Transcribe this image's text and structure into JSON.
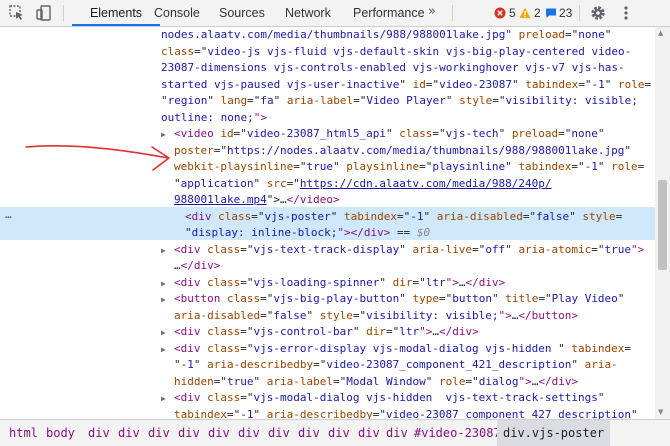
{
  "toolbar": {
    "tabs": [
      "Elements",
      "Console",
      "Sources",
      "Network",
      "Performance"
    ],
    "more": "»",
    "errors": "5",
    "warnings": "2",
    "messages": "23"
  },
  "dom": {
    "l0": [
      "nodes.alaatv.com/media/thumbnails/988/988001lake.jpg\"",
      " preload",
      "=\"",
      "none",
      "\""
    ],
    "l1": [
      "class",
      "=\"",
      "video-js vjs-fluid vjs-default-skin vjs-big-play-centered video-"
    ],
    "l2": [
      "23087-dimensions vjs-controls-enabled vjs-workinghover vjs-v7 vjs-has-"
    ],
    "l3": [
      "started vjs-paused vjs-user-inactive",
      "\" ",
      "id",
      "=\"",
      "video-23087",
      "\" ",
      "tabindex",
      "=\"",
      "-1",
      "\" ",
      "role",
      "="
    ],
    "l4": [
      "\"",
      "region",
      "\" ",
      "lang",
      "=\"",
      "fa",
      "\" ",
      "aria-label",
      "=\"",
      "Video Player",
      "\" ",
      "style",
      "=\"",
      "visibility: visible;"
    ],
    "l5": [
      "outline: none;",
      "\">"
    ],
    "l6": [
      "<video",
      " id",
      "=\"",
      "video-23087_html5_api",
      "\" ",
      "class",
      "=\"",
      "vjs-tech",
      "\" ",
      "preload",
      "=\"",
      "none",
      "\""
    ],
    "l7": [
      "poster",
      "=\"",
      "https://nodes.alaatv.com/media/thumbnails/988/988001lake.jpg",
      "\""
    ],
    "l8": [
      "webkit-playsinline",
      "=\"",
      "true",
      "\" ",
      "playsinline",
      "=\"",
      "playsinline",
      "\" ",
      "tabindex",
      "=\"",
      "-1",
      "\" ",
      "role",
      "="
    ],
    "l9": [
      "\"",
      "application",
      "\" ",
      "src",
      "=\"",
      "https://cdn.alaatv.com/media/988/240p/"
    ],
    "l10": [
      "988001lake.mp4",
      "\">",
      "…",
      "</video>"
    ],
    "l11": [
      "<div",
      " class",
      "=\"",
      "vjs-poster",
      "\" ",
      "tabindex",
      "=\"",
      "-1",
      "\" ",
      "aria-disabled",
      "=\"",
      "false",
      "\" ",
      "style",
      "="
    ],
    "l12": [
      "\"",
      "display: inline-block;",
      "\">",
      "</div>",
      " == ",
      "$0"
    ],
    "l13": [
      "<div",
      " class",
      "=\"",
      "vjs-text-track-display",
      "\" ",
      "aria-live",
      "=\"",
      "off",
      "\" ",
      "aria-atomic",
      "=\"",
      "true",
      "\">"
    ],
    "l14": [
      "…",
      "</div>"
    ],
    "l15": [
      "<div",
      " class",
      "=\"",
      "vjs-loading-spinner",
      "\" ",
      "dir",
      "=\"",
      "ltr",
      "\">",
      "…",
      "</div>"
    ],
    "l16": [
      "<button",
      " class",
      "=\"",
      "vjs-big-play-button",
      "\" ",
      "type",
      "=\"",
      "button",
      "\" ",
      "title",
      "=\"",
      "Play Video",
      "\""
    ],
    "l17": [
      "aria-disabled",
      "=\"",
      "false",
      "\" ",
      "style",
      "=\"",
      "visibility: visible;",
      "\">",
      "…",
      "</button>"
    ],
    "l18": [
      "<div",
      " class",
      "=\"",
      "vjs-control-bar",
      "\" ",
      "dir",
      "=\"",
      "ltr",
      "\">",
      "…",
      "</div>"
    ],
    "l19": [
      "<div",
      " class",
      "=\"",
      "vjs-error-display vjs-modal-dialog vjs-hidden ",
      "\" ",
      "tabindex",
      "="
    ],
    "l20": [
      "\"",
      "-1",
      "\" ",
      "aria-describedby",
      "=\"",
      "video-23087_component_421_description",
      "\" ",
      "aria-"
    ],
    "l21": [
      "hidden",
      "=\"",
      "true",
      "\" ",
      "aria-label",
      "=\"",
      "Modal Window",
      "\" ",
      "role",
      "=\"",
      "dialog",
      "\">",
      "…",
      "</div>"
    ],
    "l22": [
      "<div",
      " class",
      "=\"",
      "vjs-modal-dialog vjs-hidden  vjs-text-track-settings",
      "\""
    ],
    "l23": [
      "tabindex",
      "=\"",
      "-1",
      "\" ",
      "aria-describedby",
      "=\"",
      "video-23087_component_427_description",
      "\""
    ],
    "dots": "…"
  },
  "breadcrumb": [
    "html",
    "body",
    "div",
    "div",
    "div",
    "div",
    "div",
    "div",
    "div",
    "div",
    "div",
    "div",
    "div",
    "#video-23087",
    "div.vjs-poster"
  ],
  "colors": {
    "tag": "#881280",
    "attr_name": "#994500",
    "attr_value": "#1a1aa6",
    "selected_row": "#cfe8fc",
    "active_tab": "#1a73e8",
    "annotation_arrow": "#e03030"
  },
  "icons": [
    "inspect-element-icon",
    "device-toolbar-icon",
    "error-icon",
    "warning-icon",
    "message-icon",
    "settings-gear-icon",
    "kebab-menu-icon",
    "expand-triangle-icon"
  ]
}
